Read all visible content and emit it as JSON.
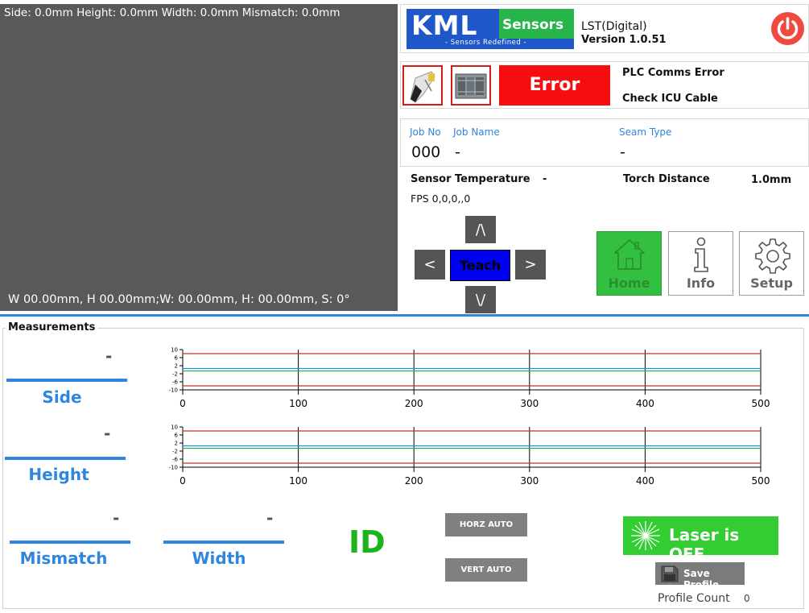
{
  "camera": {
    "top_overlay": "Side: 0.0mm Height: 0.0mm Width: 0.0mm Mismatch: 0.0mm",
    "bottom_overlay": "W 00.00mm,  H 00.00mm;W: 00.00mm, H: 00.00mm, S: 0°"
  },
  "header": {
    "logo_main": "KML",
    "logo_sub": "Sensors",
    "logo_tagline": "- Sensors Redefined -",
    "product_name": "LST(Digital)",
    "version": "Version 1.0.51",
    "power_icon": "power-icon"
  },
  "status": {
    "sensor_icon": "laser-sensor-icon",
    "plc_icon": "plc-icon",
    "error_label": "Error",
    "message_line1": "PLC Comms Error",
    "message_line2": "Check ICU Cable",
    "colors": {
      "error": "#f60e0e",
      "fault_border": "#d11b1b"
    }
  },
  "job": {
    "job_no_label": "Job No",
    "job_name_label": "Job Name",
    "seam_type_label": "Seam Type",
    "job_no": "000",
    "job_name": "-",
    "seam_type": "-"
  },
  "info": {
    "sensor_temp_label": "Sensor Temperature",
    "sensor_temp_value": "-",
    "torch_distance_label": "Torch Distance",
    "torch_distance_value": "1.0mm",
    "fps": "FPS 0,0,0,,0"
  },
  "jog": {
    "up": "/\\",
    "down": "\\/",
    "left": "<",
    "right": ">",
    "teach": "Teach"
  },
  "nav": {
    "home": "Home",
    "info": "Info",
    "setup": "Setup",
    "home_icon": "house-icon",
    "info_icon": "info-icon",
    "setup_icon": "gear-icon"
  },
  "measurements": {
    "title": "Measurements",
    "side_label": "Side",
    "side_value": "-",
    "height_label": "Height",
    "height_value": "-",
    "mismatch_label": "Mismatch",
    "mismatch_value": "-",
    "width_label": "Width",
    "width_value": "-",
    "id_text": "ID",
    "horz_auto": "HORZ AUTO",
    "vert_auto": "VERT AUTO",
    "laser_label": "Laser is OFF",
    "laser_icon": "laser-burst-icon",
    "save_profile": "Save Profile",
    "save_icon": "floppy-disk-icon",
    "profile_count_label": "Profile Count",
    "profile_count": "0",
    "colors": {
      "accent": "#2e86de",
      "id": "#1db31d",
      "laser": "#33cc33"
    }
  },
  "chart_data": [
    {
      "type": "line",
      "x_ticks": [
        0,
        100,
        200,
        300,
        400,
        500
      ],
      "y_ticks": [
        10,
        6,
        2,
        -2,
        -6,
        -10
      ],
      "xlim": [
        0,
        500
      ],
      "ylim": [
        -10,
        10
      ],
      "grid": "vertical lines at x ticks",
      "series": [
        {
          "color": "#c0392b",
          "values": [
            8,
            8
          ]
        },
        {
          "color": "#2e86de",
          "values": [
            0.6,
            0.6
          ]
        },
        {
          "color": "#27ae60",
          "values": [
            -0.6,
            -0.6
          ]
        },
        {
          "color": "#c0392b",
          "values": [
            -8,
            -8
          ]
        }
      ]
    },
    {
      "type": "line",
      "x_ticks": [
        0,
        100,
        200,
        300,
        400,
        500
      ],
      "y_ticks": [
        10,
        6,
        2,
        -2,
        -6,
        -10
      ],
      "xlim": [
        0,
        500
      ],
      "ylim": [
        -10,
        10
      ],
      "grid": "vertical lines at x ticks",
      "series": [
        {
          "color": "#c0392b",
          "values": [
            8,
            8
          ]
        },
        {
          "color": "#2e86de",
          "values": [
            0.6,
            0.6
          ]
        },
        {
          "color": "#27ae60",
          "values": [
            -0.6,
            -0.6
          ]
        },
        {
          "color": "#c0392b",
          "values": [
            -8,
            -8
          ]
        }
      ]
    }
  ]
}
